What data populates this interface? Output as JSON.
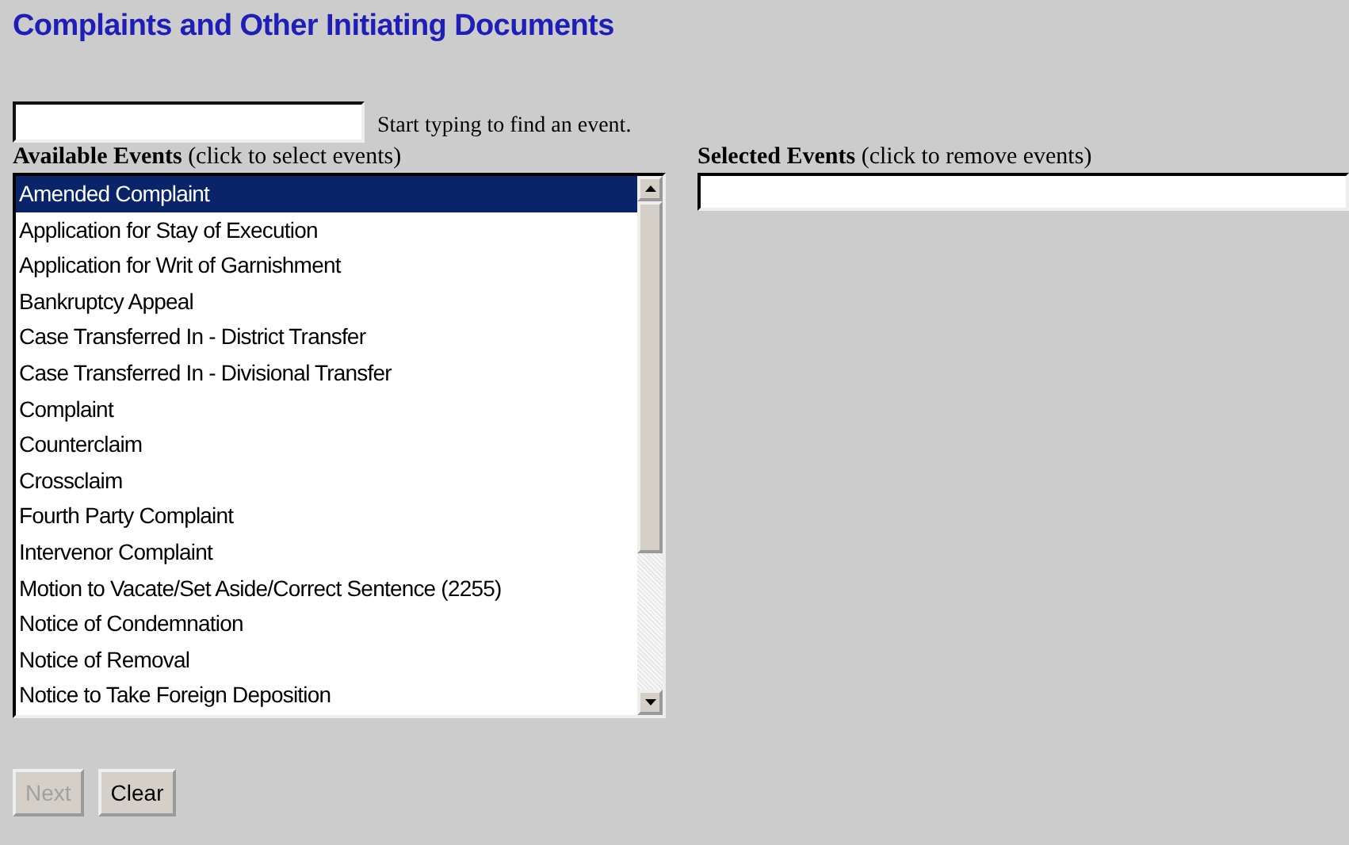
{
  "title": "Complaints and Other Initiating Documents",
  "search": {
    "hint": "Start typing to find an event."
  },
  "available": {
    "label": "Available Events",
    "note": "(click to select events)",
    "items": [
      {
        "text": "Amended Complaint",
        "selected": true
      },
      {
        "text": "Application for Stay of Execution",
        "selected": false
      },
      {
        "text": "Application for Writ of Garnishment",
        "selected": false
      },
      {
        "text": "Bankruptcy Appeal",
        "selected": false
      },
      {
        "text": "Case Transferred In - District Transfer",
        "selected": false
      },
      {
        "text": "Case Transferred In - Divisional Transfer",
        "selected": false
      },
      {
        "text": "Complaint",
        "selected": false
      },
      {
        "text": "Counterclaim",
        "selected": false
      },
      {
        "text": "Crossclaim",
        "selected": false
      },
      {
        "text": "Fourth Party Complaint",
        "selected": false
      },
      {
        "text": "Intervenor Complaint",
        "selected": false
      },
      {
        "text": "Motion to Vacate/Set Aside/Correct Sentence (2255)",
        "selected": false
      },
      {
        "text": "Notice of Condemnation",
        "selected": false
      },
      {
        "text": "Notice of Removal",
        "selected": false
      },
      {
        "text": "Notice to Take Foreign Deposition",
        "selected": false
      }
    ]
  },
  "selected_events": {
    "label": "Selected Events",
    "note": "(click to remove events)"
  },
  "buttons": [
    {
      "label": "Next",
      "disabled": true
    },
    {
      "label": "Clear",
      "disabled": false
    }
  ]
}
